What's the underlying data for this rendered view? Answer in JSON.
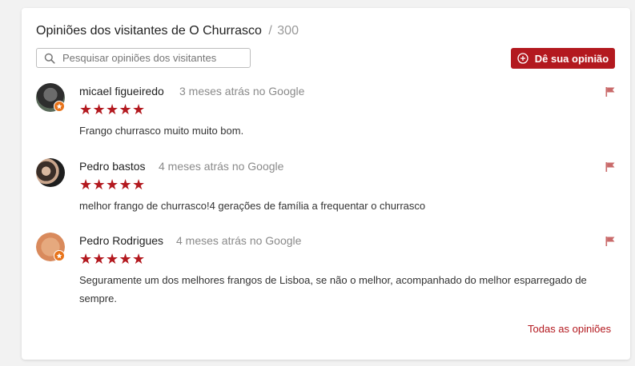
{
  "header": {
    "title": "Opiniões dos visitantes de O Churrasco",
    "separator": "/",
    "count": "300"
  },
  "search": {
    "placeholder": "Pesquisar opiniões dos visitantes",
    "value": ""
  },
  "add_review_button": {
    "label": "Dê sua opinião"
  },
  "reviews": [
    {
      "name": "micael figueiredo",
      "time": "3 meses atrás no Google",
      "stars": "★★★★★",
      "rating": 5,
      "text": "Frango churrasco muito muito bom."
    },
    {
      "name": "Pedro bastos",
      "time": "4 meses atrás no Google",
      "stars": "★★★★★",
      "rating": 5,
      "text": "melhor frango de churrasco!4 gerações de família a frequentar o churrasco"
    },
    {
      "name": "Pedro Rodrigues",
      "time": "4 meses atrás no Google",
      "stars": "★★★★★",
      "rating": 5,
      "text": "Seguramente um dos melhores frangos de Lisboa, se não o melhor, acompanhado do melhor esparregado de sempre."
    }
  ],
  "footer": {
    "all_reviews_label": "Todas as opiniões"
  },
  "colors": {
    "accent": "#b3191f",
    "badge": "#e8731a",
    "muted_text": "#8a8a8a"
  }
}
